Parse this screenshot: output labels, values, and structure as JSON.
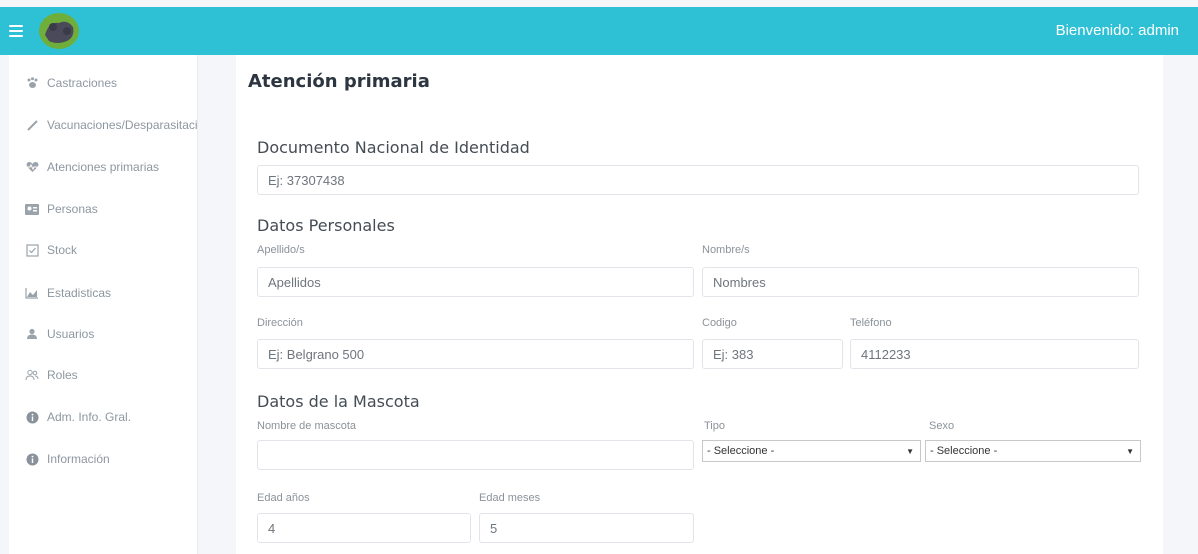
{
  "header": {
    "welcome": "Bienvenido: admin",
    "bar_color": "#2ec1d5"
  },
  "sidebar": {
    "items": [
      {
        "label": "Castraciones",
        "icon": "paw-icon"
      },
      {
        "label": "Vacunaciones/Desparasitaciones",
        "icon": "syringe-icon"
      },
      {
        "label": "Atenciones primarias",
        "icon": "heartbeat-icon"
      },
      {
        "label": "Personas",
        "icon": "id-card-icon"
      },
      {
        "label": "Stock",
        "icon": "check-square-icon"
      },
      {
        "label": "Estadisticas",
        "icon": "chart-icon"
      },
      {
        "label": "Usuarios",
        "icon": "user-icon"
      },
      {
        "label": "Roles",
        "icon": "users-icon"
      },
      {
        "label": "Adm. Info. Gral.",
        "icon": "info-circle-icon"
      },
      {
        "label": "Información",
        "icon": "info-circle-icon"
      }
    ]
  },
  "main": {
    "title": "Atención primaria",
    "dni": {
      "section_title": "Documento Nacional de Identidad",
      "placeholder": "Ej: 37307438"
    },
    "personal": {
      "section_title": "Datos Personales",
      "apellido_label": "Apellido/s",
      "apellido_placeholder": "Apellidos",
      "nombre_label": "Nombre/s",
      "nombre_placeholder": "Nombres",
      "direccion_label": "Dirección",
      "direccion_placeholder": "Ej: Belgrano 500",
      "codigo_label": "Codigo",
      "codigo_placeholder": "Ej: 383",
      "telefono_label": "Teléfono",
      "telefono_placeholder": "4112233"
    },
    "pet": {
      "section_title": "Datos de la Mascota",
      "nombre_label": "Nombre de mascota",
      "nombre_value": "",
      "tipo_label": "Tipo",
      "tipo_selected": "- Seleccione -",
      "sexo_label": "Sexo",
      "sexo_selected": "- Seleccione -",
      "edad_anios_label": "Edad años",
      "edad_anios_value": "4",
      "edad_meses_label": "Edad meses",
      "edad_meses_value": "5"
    }
  }
}
